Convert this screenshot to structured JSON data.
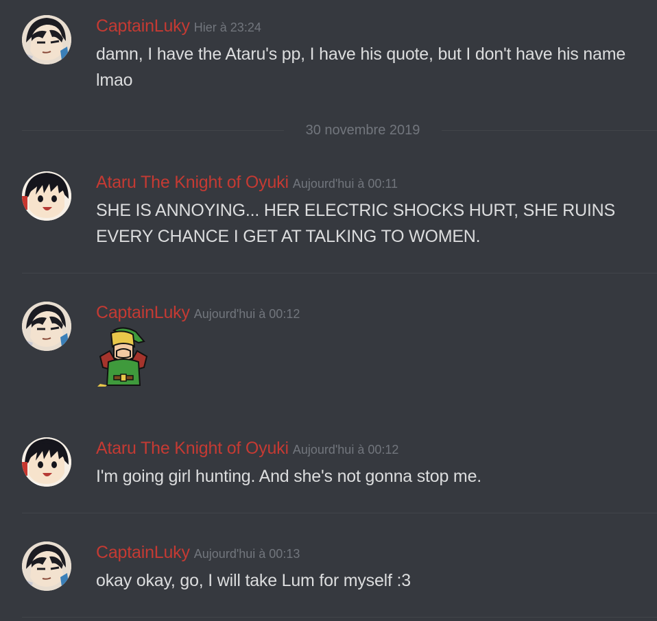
{
  "date_divider": "30 novembre 2019",
  "messages": [
    {
      "username": "CaptainLuky",
      "timestamp": "Hier à 23:24",
      "text": "damn, I have the Ataru's pp, I have his quote, but I don't have his name lmao",
      "avatar": "captainluky-avatar"
    },
    {
      "username": "Ataru The Knight of Oyuki",
      "timestamp": "Aujourd'hui à 00:11",
      "text": "SHE IS ANNOYING... HER ELECTRIC SHOCKS HURT, SHE RUINS EVERY CHANCE I GET AT TALKING TO WOMEN.",
      "avatar": "ataru-avatar"
    },
    {
      "username": "CaptainLuky",
      "timestamp": "Aujourd'hui à 00:12",
      "emoji": "link-laughing-emoji",
      "avatar": "captainluky-avatar"
    },
    {
      "username": "Ataru The Knight of Oyuki",
      "timestamp": "Aujourd'hui à 00:12",
      "text": "I'm going girl hunting. And she's not gonna stop me.",
      "avatar": "ataru-avatar"
    },
    {
      "username": "CaptainLuky",
      "timestamp": "Aujourd'hui à 00:13",
      "text": "okay okay, go, I will take Lum for myself :3",
      "avatar": "captainluky-avatar"
    }
  ],
  "colors": {
    "background": "#36393f",
    "username": "#c53a33",
    "timestamp": "#72767d",
    "text": "#dcddde",
    "divider": "#42454a"
  }
}
